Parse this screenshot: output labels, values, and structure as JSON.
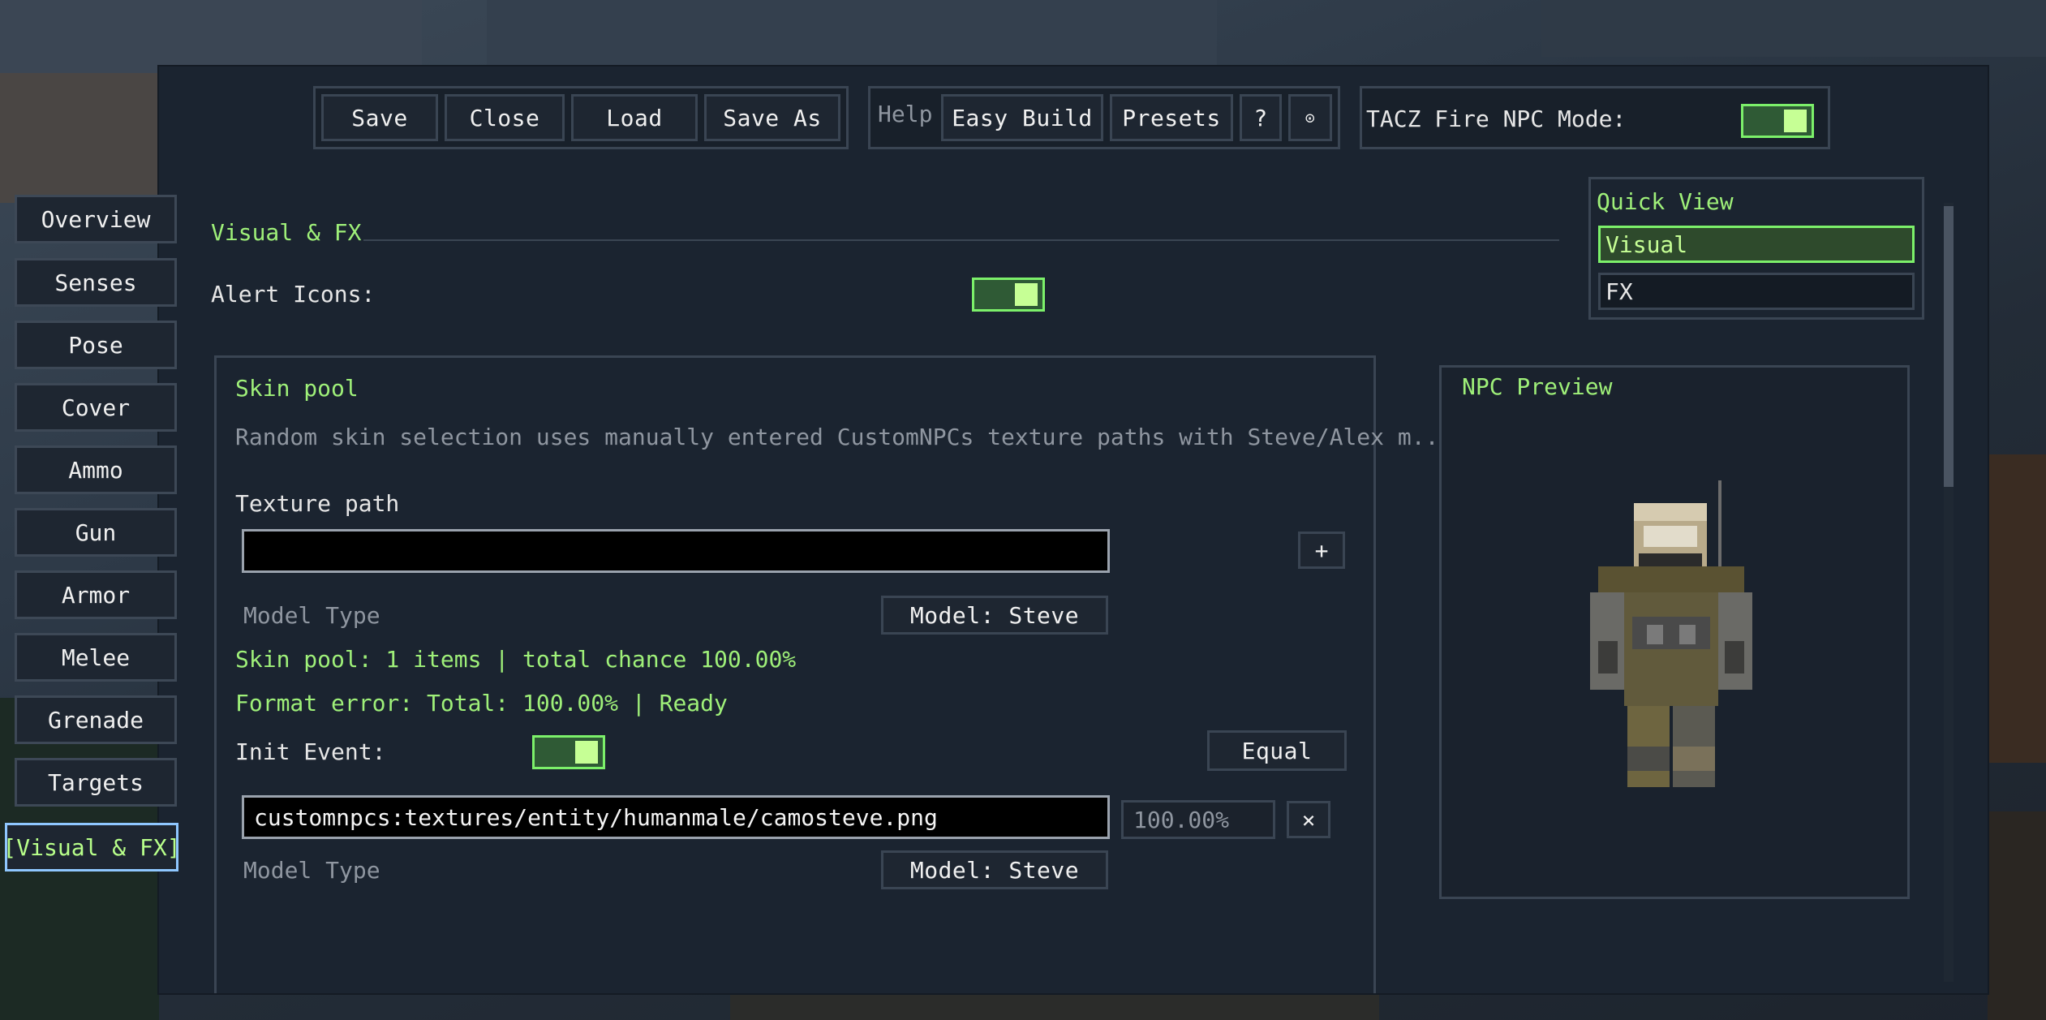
{
  "toolbar": {
    "save": "Save",
    "close": "Close",
    "load": "Load",
    "save_as": "Save As",
    "help": "Help",
    "easy_build": "Easy Build",
    "presets": "Presets",
    "question": "?",
    "settings_glyph": "⊙",
    "tacz_label": "TACZ Fire NPC Mode:",
    "tacz_enabled": true
  },
  "sidebar": {
    "items": [
      {
        "label": "Overview"
      },
      {
        "label": "Senses"
      },
      {
        "label": "Pose"
      },
      {
        "label": "Cover"
      },
      {
        "label": "Ammo"
      },
      {
        "label": "Gun"
      },
      {
        "label": "Armor"
      },
      {
        "label": "Melee"
      },
      {
        "label": "Grenade"
      },
      {
        "label": "Targets"
      },
      {
        "label": "[Visual & FX]",
        "active": true
      }
    ]
  },
  "section": {
    "title": "Visual & FX",
    "alert_icons_label": "Alert Icons:",
    "alert_icons_enabled": true
  },
  "skin_pool": {
    "title": "Skin pool",
    "description": "Random skin selection uses manually entered CustomNPCs texture paths with Steve/Alex m...",
    "texture_path_label": "Texture path",
    "texture_path_value": "",
    "add_label": "+",
    "model_type_label": "Model Type",
    "model_button": "Model: Steve",
    "summary": "Skin pool: 1 items | total chance 100.00%",
    "status": "Format error: Total: 100.00% | Ready",
    "init_event_label": "Init Event:",
    "init_event_enabled": true,
    "equal_label": "Equal",
    "entry": {
      "path": "customnpcs:textures/entity/humanmale/camosteve.png",
      "chance": "100.00%",
      "remove_label": "×",
      "model_type_label": "Model Type",
      "model_button": "Model: Steve"
    }
  },
  "quick_view": {
    "title": "Quick View",
    "items": [
      {
        "label": "Visual",
        "active": true
      },
      {
        "label": "FX"
      }
    ]
  },
  "preview": {
    "title": "NPC Preview"
  },
  "colors": {
    "accent_green": "#9ff079",
    "panel_bg": "#1b2430",
    "border": "#3a4553",
    "active_border": "#8fc7ff"
  }
}
